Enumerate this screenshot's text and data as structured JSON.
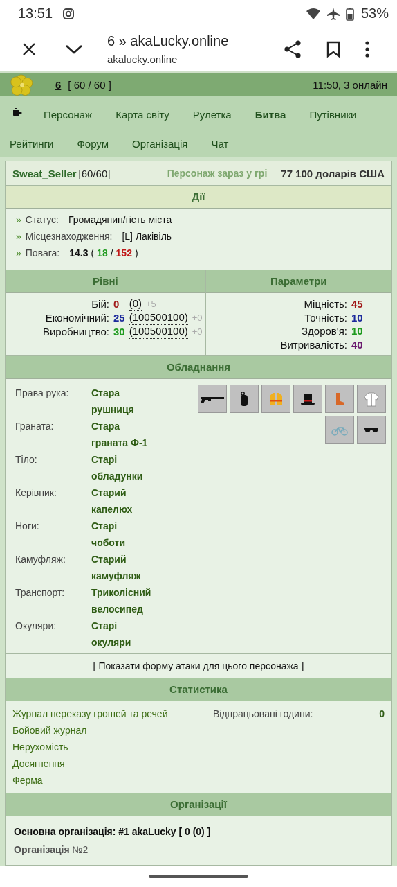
{
  "system_bar": {
    "time": "13:51",
    "battery": "53%"
  },
  "browser": {
    "title": "6 » akaLucky.online",
    "url": "akalucky.online"
  },
  "game_header": {
    "level": "6",
    "energy": "[ 60 / 60 ]",
    "server": "11:50, 3 онлайн"
  },
  "nav": [
    {
      "label": "Персонаж",
      "selected": false
    },
    {
      "label": "Карта світу",
      "selected": false
    },
    {
      "label": "Рулетка",
      "selected": false
    },
    {
      "label": "Битва",
      "selected": true
    },
    {
      "label": "Путівники",
      "selected": false
    },
    {
      "label": "Рейтинги",
      "selected": false
    },
    {
      "label": "Форум",
      "selected": false
    },
    {
      "label": "Організація",
      "selected": false
    },
    {
      "label": "Чат",
      "selected": false
    }
  ],
  "profile": {
    "name": "Sweat_Seller",
    "energy": "[60/60]",
    "presence": "Персонаж зараз у грі",
    "money": "77 100 доларів США"
  },
  "actions": {
    "title": "Дії",
    "rows": [
      {
        "bullet": "»",
        "label": "Статус:",
        "value": [
          {
            "text": "Громадянин/гість міста",
            "color": "#111111",
            "bold": false
          }
        ]
      },
      {
        "bullet": "»",
        "label": "Місцезнаходження:",
        "value": [
          {
            "text": "[L] Лаківіль",
            "color": "#111111",
            "bold": false
          }
        ]
      },
      {
        "bullet": "»",
        "label": "Повага:",
        "value": [
          {
            "text": "14.3",
            "color": "#111111",
            "bold": true
          },
          {
            "text": "("
          },
          {
            "text": "18",
            "color": "#1e9a1e",
            "bold": true
          },
          {
            "text": "/"
          },
          {
            "text": "152",
            "color": "#c01818",
            "bold": true
          },
          {
            "text": ")"
          }
        ]
      }
    ]
  },
  "levels": {
    "title": "Рівні",
    "rows": [
      {
        "label": "Бій:",
        "value": "0",
        "color": "#a01818",
        "exp": "(0)",
        "bonus": "+5"
      },
      {
        "label": "Економічний:",
        "value": "25",
        "color": "#1c2a9c",
        "exp": "(100500100)",
        "bonus": "+0"
      },
      {
        "label": "Виробництво:",
        "value": "30",
        "color": "#1e9a1e",
        "exp": "(100500100)",
        "bonus": "+0"
      }
    ]
  },
  "parameters": {
    "title": "Параметри",
    "rows": [
      {
        "label": "Міцність:",
        "value": "45",
        "color": "#a01818"
      },
      {
        "label": "Точність:",
        "value": "10",
        "color": "#1c2a9c"
      },
      {
        "label": "Здоров'я:",
        "value": "10",
        "color": "#1e9a1e"
      },
      {
        "label": "Витривалість:",
        "value": "40",
        "color": "#6a1a6e"
      }
    ]
  },
  "equipment": {
    "title": "Обладнання",
    "rows": [
      {
        "slot": "Права рука:",
        "item": "Стара рушниця"
      },
      {
        "slot": "Граната:",
        "item": "Стара граната Ф-1"
      },
      {
        "slot": "Тіло:",
        "item": "Старі обладунки"
      },
      {
        "slot": "Керівник:",
        "item": "Старий капелюх"
      },
      {
        "slot": "Ноги:",
        "item": "Старі чоботи"
      },
      {
        "slot": "Камуфляж:",
        "item": "Старий камуфляж"
      },
      {
        "slot": "Транспорт:",
        "item": "Триколісний велосипед"
      },
      {
        "slot": "Окуляри:",
        "item": "Старі окуляри"
      }
    ]
  },
  "attack_link": "[ Показати форму атаки для цього персонажа ]",
  "statistics": {
    "title": "Статистика",
    "links": [
      "Журнал переказу грошей та речей",
      "Бойовий журнал",
      "Нерухомість",
      "Досягнення",
      "Ферма"
    ],
    "hours_label": "Відпрацьовані години:",
    "hours": "0"
  },
  "organizations": {
    "title": "Організації",
    "main": "Основна організація: #1 akaLucky [ 0 (0) ]",
    "second": "**Організація** №2"
  }
}
